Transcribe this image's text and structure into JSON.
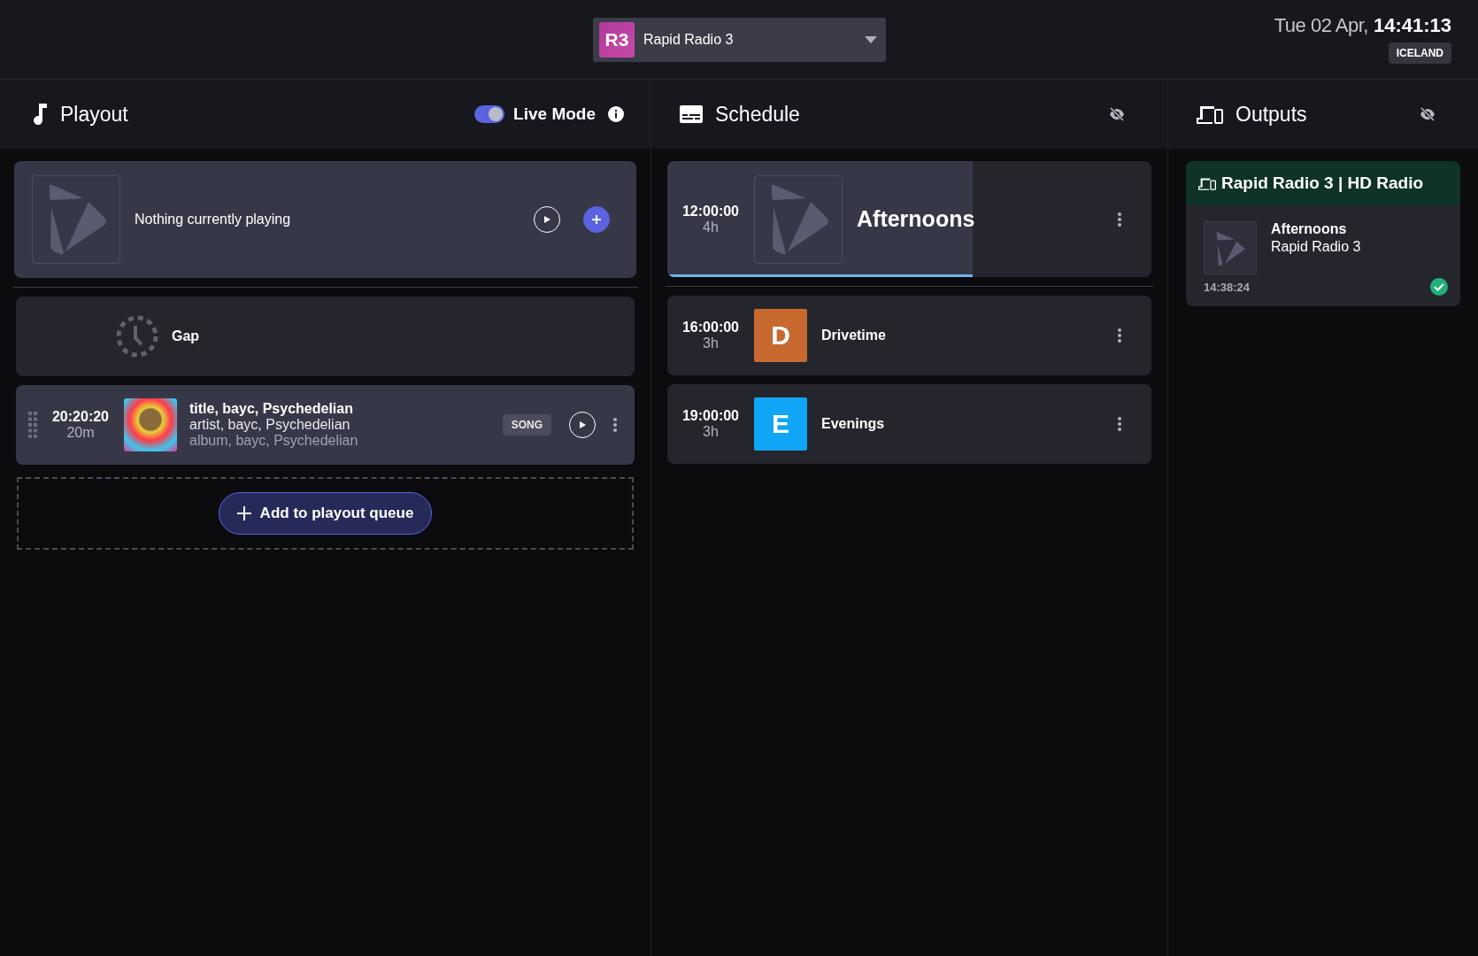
{
  "header": {
    "station": {
      "badge": "R3",
      "name": "Rapid Radio 3"
    },
    "date": "Tue 02 Apr,",
    "time": "14:41:13",
    "timezone": "ICELAND"
  },
  "playout": {
    "title": "Playout",
    "live_mode": {
      "label": "Live Mode",
      "on": true
    },
    "now_playing": "Nothing currently playing",
    "queue": [
      {
        "kind": "gap",
        "label": "Gap"
      },
      {
        "kind": "song",
        "time": "20:20:20",
        "duration": "20m",
        "title": "title, bayc, Psychedelian",
        "artist": "artist, bayc, Psychedelian",
        "album": "album, bayc, Psychedelian",
        "tag": "SONG"
      }
    ],
    "add_button": "Add to playout queue"
  },
  "schedule": {
    "title": "Schedule",
    "items": [
      {
        "time": "12:00:00",
        "duration": "4h",
        "name": "Afternoons",
        "current": true,
        "level": 0.63
      },
      {
        "time": "16:00:00",
        "duration": "3h",
        "name": "Drivetime",
        "current": false,
        "letter": "D",
        "color": "#c8692f"
      },
      {
        "time": "19:00:00",
        "duration": "3h",
        "name": "Evenings",
        "current": false,
        "letter": "E",
        "color": "#10a6f5"
      }
    ]
  },
  "outputs": {
    "title": "Outputs",
    "cards": [
      {
        "name": "Rapid Radio 3 | HD Radio",
        "show": "Afternoons",
        "station": "Rapid Radio 3",
        "time": "14:38:24",
        "ok": true
      }
    ]
  }
}
